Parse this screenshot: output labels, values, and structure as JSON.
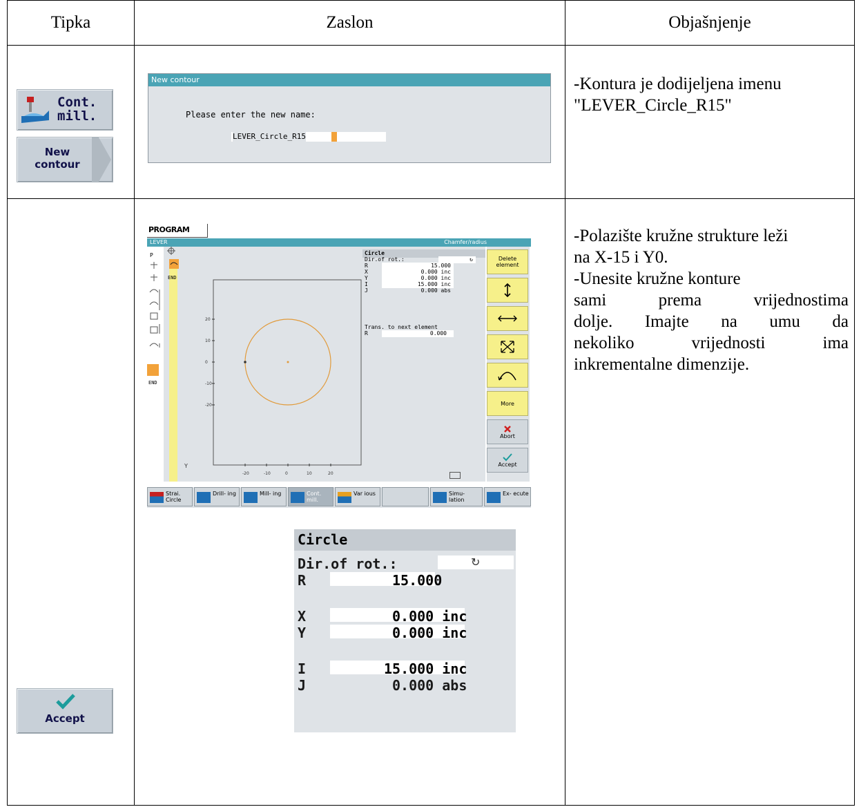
{
  "table": {
    "headers": [
      "Tipka",
      "Zaslon",
      "Objašnjenje"
    ]
  },
  "row1": {
    "keys": {
      "cont_mill": [
        "Cont.",
        "mill."
      ],
      "new_contour": [
        "New",
        "contour"
      ]
    },
    "dialog": {
      "title": "New contour",
      "prompt": "Please enter the new name:",
      "value": "LEVER_Circle_R15"
    },
    "explanation": [
      "-Kontura je dodijeljena imenu",
      "\"LEVER_Circle_R15\""
    ]
  },
  "row2": {
    "accept_key": "Accept",
    "screen": {
      "program_tab": "PROGRAM",
      "header_left": "LEVER",
      "header_right": "Chamfer/radius",
      "left_strip": [
        "P",
        "END"
      ],
      "left_strip_end2": "END",
      "form": {
        "title": "Circle",
        "rows": [
          {
            "label": "Dir.of rot.:",
            "value": "↻"
          },
          {
            "label": "R",
            "value": "15.000"
          },
          {
            "label": "X",
            "value": "0.000 inc"
          },
          {
            "label": "Y",
            "value": "0.000 inc"
          },
          {
            "label": "I",
            "value": "15.000 inc"
          },
          {
            "label": "J",
            "value": "0.000 abs"
          }
        ],
        "trans_label": "Trans. to next element",
        "trans_row": {
          "label": "R",
          "value": "0.000"
        }
      },
      "vertical_softkeys": [
        {
          "label": "Delete element",
          "style": "yellow"
        },
        {
          "label": "",
          "icon": "vertical-arrow-icon",
          "style": "yellow"
        },
        {
          "label": "",
          "icon": "horizontal-arrow-icon",
          "style": "yellow"
        },
        {
          "label": "",
          "icon": "expand-arrows-icon",
          "style": "yellow"
        },
        {
          "label": "",
          "icon": "arc-icon",
          "style": "yellow"
        },
        {
          "label": "More",
          "style": "yellow"
        },
        {
          "label": "Abort",
          "icon": "abort-x-icon",
          "style": "grey"
        },
        {
          "label": "Accept",
          "icon": "checkmark-icon",
          "style": "grey"
        }
      ],
      "horizontal_softkeys": [
        {
          "label": "Strai. Circle"
        },
        {
          "label": "Drill- ing"
        },
        {
          "label": "Mill- ing"
        },
        {
          "label": "Cont. mill."
        },
        {
          "label": "Var ious"
        },
        {
          "label": ""
        },
        {
          "label": "Simu- lation"
        },
        {
          "label": "Ex- ecute"
        }
      ],
      "axis": {
        "y_ticks": [
          "20",
          "10",
          "0",
          "-10",
          "-20"
        ],
        "x_ticks": [
          "-20",
          "-10",
          "0",
          "10",
          "20"
        ],
        "y_label": "Y"
      }
    },
    "zoom": {
      "title": "Circle",
      "dir_label": "Dir.of rot.:",
      "dir_value": "↻",
      "r_label": "R",
      "r_value": "15.000",
      "x_label": "X",
      "x_value": "0.000 inc",
      "y_label": "Y",
      "y_value": "0.000 inc",
      "i_label": "I",
      "i_value": "15.000 inc",
      "j_label": "J",
      "j_value": "0.000 abs"
    },
    "explanation": {
      "p1": "-Polazište kružne strukture leži",
      "p2": "na X-15 i Y0.",
      "p3": "-Unesite kružne konture",
      "p4_words": [
        "sami",
        "prema",
        "vrijednostima"
      ],
      "p5_words": [
        "dolje.",
        "Imajte",
        "na",
        "umu",
        "da"
      ],
      "p6_words": [
        "nekoliko",
        "vrijednosti",
        "ima"
      ],
      "p7": "inkrementalne dimenzije."
    }
  },
  "colors": {
    "titlebar": "#4aa4b5",
    "panel": "#dfe3e7",
    "yellow": "#f6f08a",
    "orange_circle": "#e19a3a",
    "accept_check": "#20a0a0"
  }
}
